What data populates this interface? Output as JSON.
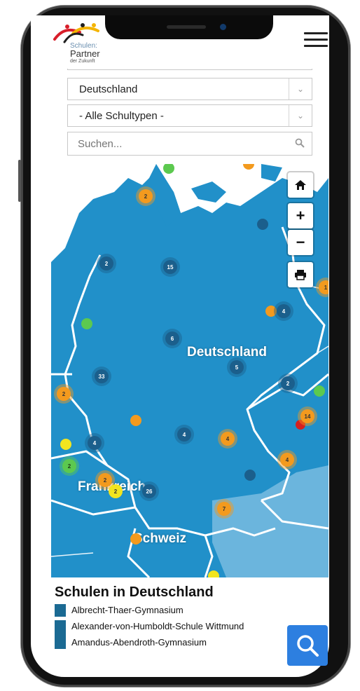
{
  "logo": {
    "line1": "Schulen:",
    "line2": "Partner",
    "line3": "der Zukunft"
  },
  "filters": {
    "country": "Deutschland",
    "school_type": "- Alle Schultypen -",
    "search_placeholder": "Suchen..."
  },
  "map": {
    "controls": {
      "home": "home-icon",
      "zoom_in": "+",
      "zoom_out": "−",
      "print": "print-icon"
    },
    "labels": {
      "germany": "Deutschland",
      "france": "Frankreich",
      "switzerland": "Schweiz"
    },
    "clusters": [
      {
        "type": "orange",
        "count": "2"
      },
      {
        "type": "blue",
        "count": "2"
      },
      {
        "type": "blue",
        "count": "15"
      },
      {
        "type": "blue",
        "count": "4"
      },
      {
        "type": "blue",
        "count": "6"
      },
      {
        "type": "blue",
        "count": "33"
      },
      {
        "type": "blue",
        "count": "5"
      },
      {
        "type": "blue",
        "count": "2"
      },
      {
        "type": "orange",
        "count": "2"
      },
      {
        "type": "orange",
        "count": "14"
      },
      {
        "type": "blue",
        "count": "4"
      },
      {
        "type": "blue",
        "count": "4"
      },
      {
        "type": "orange",
        "count": "4"
      },
      {
        "type": "orange",
        "count": "4"
      },
      {
        "type": "green",
        "count": "2"
      },
      {
        "type": "orange",
        "count": "2"
      },
      {
        "type": "yellow",
        "count": "2"
      },
      {
        "type": "blue",
        "count": "26"
      },
      {
        "type": "orange",
        "count": "7"
      },
      {
        "type": "orange",
        "count": "1"
      }
    ]
  },
  "list": {
    "title": "Schulen in Deutschland",
    "items": [
      "Albrecht-Thaer-Gymnasium",
      "Alexander-von-Humboldt-Schule Wittmund",
      "Amandus-Abendroth-Gymnasium"
    ]
  },
  "colors": {
    "map_sea": "#2190c9",
    "accent": "#2d7fe0",
    "cluster_blue": "#1b5f8c",
    "cluster_orange": "#f39a1e"
  }
}
